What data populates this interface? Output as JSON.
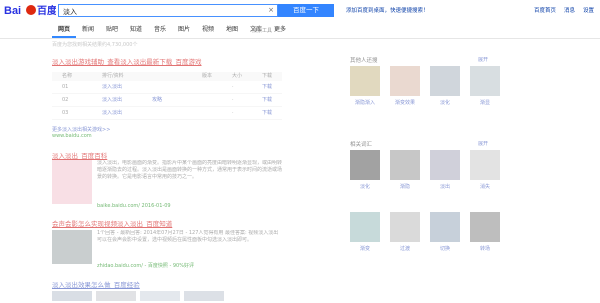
{
  "header": {
    "search_value": "淡入",
    "search_button": "百度一下",
    "promo": "添加百度到桌面，快速便捷搜索！",
    "links": [
      "百度首页",
      "消息",
      "设置"
    ]
  },
  "tabs": [
    "网页",
    "新闻",
    "贴吧",
    "知道",
    "音乐",
    "图片",
    "视频",
    "地图",
    "文库",
    "更多"
  ],
  "tab_tool": "搜索工具",
  "stats": "百度为您找到相关结果约4,730,000个",
  "results": [
    {
      "title": "淡入淡出游戏辅助_查看淡入淡出最新下载_百度游戏",
      "table_headers": [
        "",
        "名称",
        "",
        "排行/资料",
        "",
        "版本",
        "大小",
        "下载"
      ],
      "table_rows": [
        [
          "",
          "01",
          "",
          "淡入淡出",
          "",
          "",
          "·",
          "下载"
        ],
        [
          "",
          "02",
          "",
          "淡入淡出",
          "攻略",
          "",
          "·",
          "下载"
        ],
        [
          "",
          "03",
          "",
          "淡入淡出",
          "",
          "",
          "·",
          "下载"
        ]
      ],
      "footer": "更多淡入淡出相关游戏>>",
      "url": "www.baidu.com"
    },
    {
      "title": "淡入淡出_百度百科",
      "snippet": "淡入淡出，电影画面的渐变。指影片中某个画面的亮度由暗转明逐渐显现，或由明转暗逐渐隐去的过程。淡入淡出是画面转换的一种方式，通常用于表示时间的流逝或场景的转换。它是电影语言中常用的技巧之一。",
      "url": "baike.baidu.com/ 2016-01-09"
    },
    {
      "title": "会声会影怎么实现视频淡入淡出_百度知道",
      "snippet": "1个回答 - 最新回答: 2014年07月27日 - 127人觉得有用 最佳答案: 视频淡入淡出可以在会声会影中设置，选中视频后在属性面板中勾选淡入淡出即可。",
      "url": "zhidao.baidu.com/ - 百度快照 - 90%好评"
    },
    {
      "title": "淡入淡出效果怎么做_百度经验"
    }
  ],
  "right_panel": {
    "section1": {
      "title": "其他人还搜",
      "more": "展开",
      "items": [
        "渐隐渐入",
        "渐变效果",
        "淡化",
        "渐显"
      ]
    },
    "section2": {
      "title": "相关词汇",
      "more": "展开",
      "items": [
        "淡化",
        "渐隐",
        "淡出",
        "消失",
        "渐变",
        "过渡",
        "切换",
        "转场"
      ]
    }
  }
}
